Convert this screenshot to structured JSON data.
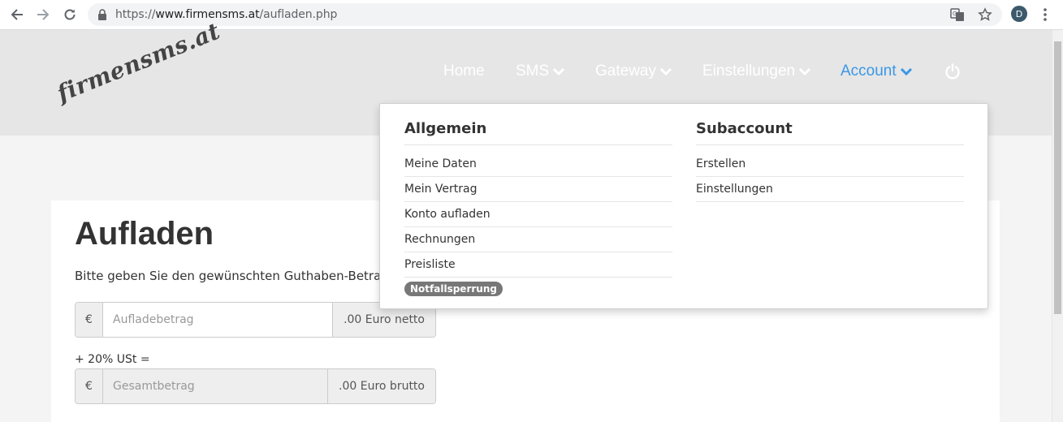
{
  "browser": {
    "url_scheme": "https://",
    "url_host": "www.firmensms.at",
    "url_path": "/aufladen.php",
    "profile_initial": "D",
    "icons": [
      "back-arrow-icon",
      "forward-arrow-icon",
      "reload-icon",
      "lock-icon",
      "translate-icon",
      "star-icon",
      "kebab-menu-icon"
    ]
  },
  "header": {
    "logo_text": "firmensms.at",
    "nav": [
      {
        "label": "Home",
        "has_dropdown": false
      },
      {
        "label": "SMS",
        "has_dropdown": true
      },
      {
        "label": "Gateway",
        "has_dropdown": true
      },
      {
        "label": "Einstellungen",
        "has_dropdown": true
      },
      {
        "label": "Account",
        "has_dropdown": true,
        "active": true
      }
    ],
    "power_icon": "power-icon",
    "active_color": "#3a97e6"
  },
  "dropdown": {
    "allgemein": {
      "heading": "Allgemein",
      "items": [
        "Meine Daten",
        "Mein Vertrag",
        "Konto aufladen",
        "Rechnungen",
        "Preisliste"
      ],
      "badge": "Notfallsperrung"
    },
    "subaccount": {
      "heading": "Subaccount",
      "items": [
        "Erstellen",
        "Einstellungen"
      ]
    }
  },
  "main": {
    "title": "Aufladen",
    "intro": "Bitte geben Sie den gewünschten Guthaben-Betrag in",
    "amount": {
      "prefix": "€",
      "placeholder": "Aufladebetrag",
      "suffix": ".00 Euro netto"
    },
    "tax_label": "+ 20% USt =",
    "total": {
      "prefix": "€",
      "placeholder": "Gesamtbetrag",
      "suffix": ".00 Euro brutto"
    }
  }
}
